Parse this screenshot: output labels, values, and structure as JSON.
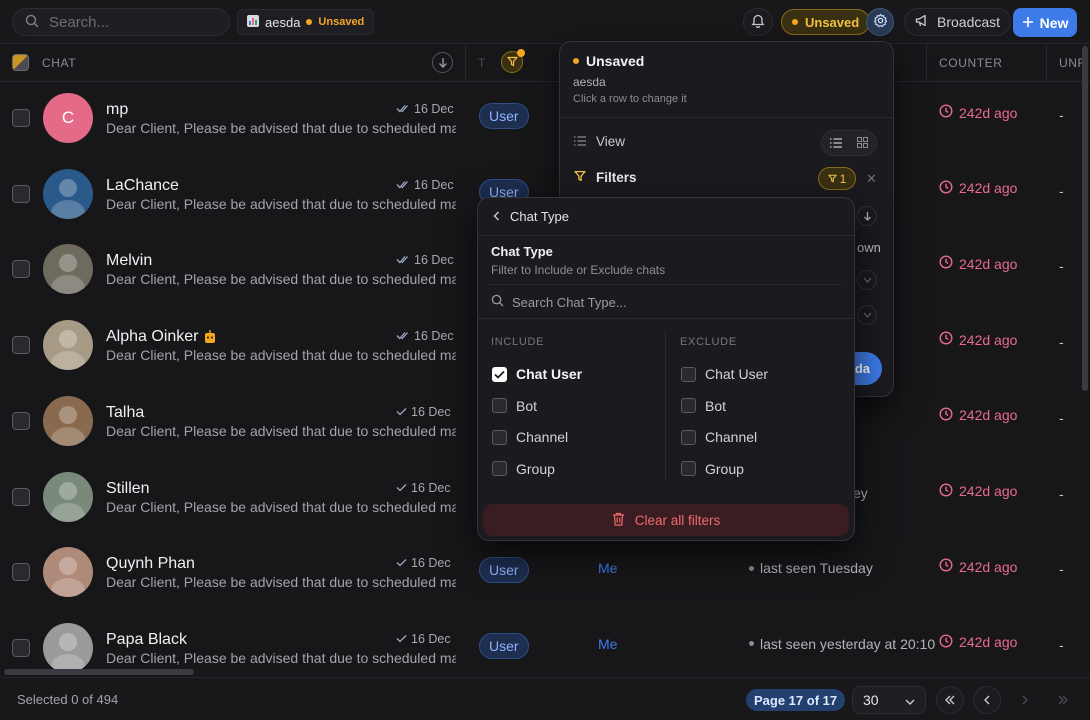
{
  "topbar": {
    "search_placeholder": "Search...",
    "preset_name": "aesda",
    "preset_status": "Unsaved",
    "unsaved_label": "Unsaved",
    "broadcast_label": "Broadcast",
    "new_label": "New"
  },
  "table": {
    "columns": {
      "chat": "CHAT",
      "type_partial": "T",
      "counter": "COUNTER",
      "unread_partial": "UNR"
    },
    "rows": [
      {
        "name": "mp",
        "avatar_initial": "C",
        "avatar_color": "#e46a87",
        "date": "16 Dec",
        "double_check": true,
        "preview": "Dear Client, Please be advised that due to scheduled ma...",
        "type": "User",
        "owner": "",
        "seen": "",
        "counter": "242d ago",
        "unread": "-"
      },
      {
        "name": "LaChance",
        "avatar_initial": "",
        "avatar_color": "#2a5a8a",
        "date": "16 Dec",
        "double_check": true,
        "preview": "Dear Client, Please be advised that due to scheduled ma...",
        "type": "User",
        "owner": "",
        "seen": "",
        "counter": "242d ago",
        "unread": "-"
      },
      {
        "name": "Melvin",
        "avatar_initial": "",
        "avatar_color": "#6e6a5e",
        "date": "16 Dec",
        "double_check": true,
        "preview": "Dear Client, Please be advised that due to scheduled ma...",
        "type": "",
        "owner": "",
        "seen": "",
        "counter": "242d ago",
        "unread": "-"
      },
      {
        "name": "Alpha Oinker",
        "avatar_initial": "",
        "avatar_color": "#a89b85",
        "date": "16 Dec",
        "double_check": true,
        "preview": "Dear Client, Please be advised that due to scheduled ma...",
        "type": "",
        "owner": "",
        "seen": "",
        "counter": "242d ago",
        "unread": "-",
        "bot_badge": true
      },
      {
        "name": "Talha",
        "avatar_initial": "",
        "avatar_color": "#8a6a4e",
        "date": "16 Dec",
        "double_check": false,
        "preview": "Dear Client, Please be advised that due to scheduled ma...",
        "type": "",
        "owner": "",
        "seen": "",
        "counter": "242d ago",
        "unread": "-"
      },
      {
        "name": "Stillen",
        "avatar_initial": "",
        "avatar_color": "#7a8a7a",
        "date": "16 Dec",
        "double_check": false,
        "preview": "Dear Client, Please be advised that due to scheduled ma...",
        "type": "",
        "owner": "",
        "seen": "ey",
        "counter": "242d ago",
        "unread": "-"
      },
      {
        "name": "Quynh Phan",
        "avatar_initial": "",
        "avatar_color": "#b08a78",
        "date": "16 Dec",
        "double_check": false,
        "preview": "Dear Client, Please be advised that due to scheduled ma...",
        "type": "User",
        "owner": "Me",
        "seen": "last seen Tuesday",
        "counter": "242d ago",
        "unread": "-"
      },
      {
        "name": "Papa Black",
        "avatar_initial": "",
        "avatar_color": "#9a9a9a",
        "date": "16 Dec",
        "double_check": false,
        "preview": "Dear Client, Please be advised that due to scheduled ma...",
        "type": "User",
        "owner": "Me",
        "seen": "last seen yesterday at 20:10",
        "counter": "242d ago",
        "unread": "-"
      }
    ]
  },
  "preset_panel": {
    "title": "Unsaved",
    "preset_name": "aesda",
    "hint": "Click a row to change it",
    "view_label": "View",
    "filters_label": "Filters",
    "filter_count": "1",
    "frag_own": "own",
    "frag_save": "da"
  },
  "chat_type_popover": {
    "back_label": "Chat Type",
    "title": "Chat Type",
    "description": "Filter to Include or Exclude chats",
    "search_placeholder": "Search Chat Type...",
    "include_header": "INCLUDE",
    "exclude_header": "EXCLUDE",
    "include_options": [
      {
        "label": "Chat User",
        "checked": true
      },
      {
        "label": "Bot",
        "checked": false
      },
      {
        "label": "Channel",
        "checked": false
      },
      {
        "label": "Group",
        "checked": false
      }
    ],
    "exclude_options": [
      {
        "label": "Chat User",
        "checked": false
      },
      {
        "label": "Bot",
        "checked": false
      },
      {
        "label": "Channel",
        "checked": false
      },
      {
        "label": "Group",
        "checked": false
      }
    ],
    "clear_label": "Clear all filters"
  },
  "footer": {
    "selected": "Selected 0 of 494",
    "page": "Page 17 of 17",
    "per_page": "30"
  },
  "colors": {
    "accent": "#3d7be8",
    "warning": "#f5a623",
    "counter": "#e86a8c",
    "danger": "#ef6b6b"
  }
}
